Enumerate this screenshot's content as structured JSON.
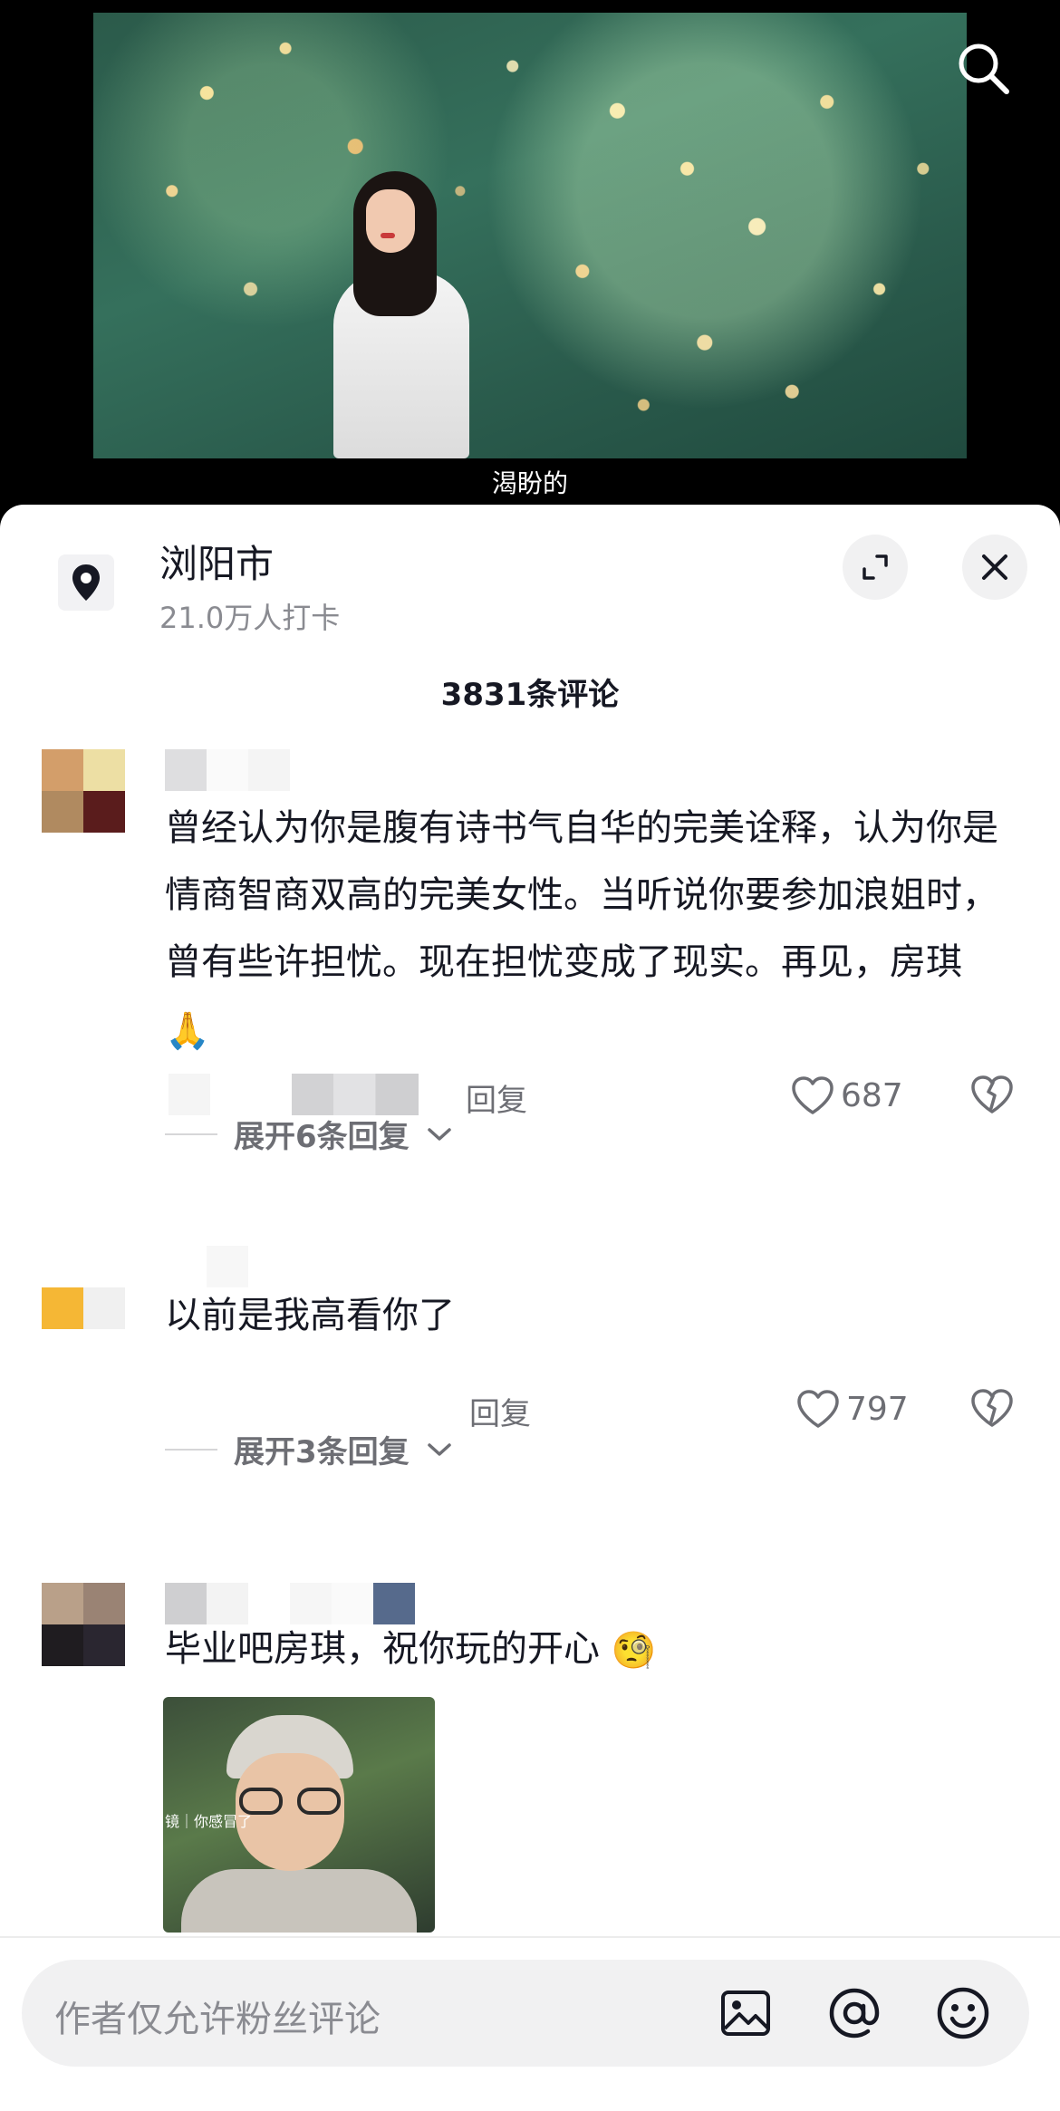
{
  "video": {
    "caption": "渴盼的"
  },
  "location": {
    "name": "浏阳市",
    "checkins": "21.0万人打卡"
  },
  "comments_header": {
    "count_label": "3831条评论"
  },
  "comments": [
    {
      "text": "曾经认为你是腹有诗书气自华的完美诠释，认为你是情商智商双高的完美女性。当听说你要参加浪姐时，曾有些许担忧。现在担忧变成了现实。再见，房琪",
      "emoji": "🙏",
      "reply_label": "回复",
      "likes": "687",
      "expand_label": "展开6条回复",
      "avatar_colors": [
        "#d39e6a",
        "#eddfa4",
        "#b08a60",
        "#5a1c1c"
      ]
    },
    {
      "text": "以前是我高看你了",
      "reply_label": "回复",
      "likes": "797",
      "expand_label": "展开3条回复",
      "avatar_colors": [
        "#ffffff",
        "#ffffff",
        "#f5b735",
        "#f0f0f0"
      ]
    },
    {
      "text": "毕业吧房琪，祝你玩的开心",
      "emoji": "🧐",
      "image_overlay_text": "镜｜你感冒了",
      "avatar_colors": [
        "#b9a089",
        "#9a8374",
        "#1f1c20",
        "#2a2630"
      ]
    }
  ],
  "input": {
    "placeholder": "作者仅允许粉丝评论"
  },
  "icons": {
    "search": "search-icon",
    "location": "location-pin-icon",
    "expand": "expand-icon",
    "close": "close-icon",
    "like": "heart-icon",
    "dislike": "broken-heart-icon",
    "chevron": "chevron-down-icon",
    "image": "image-icon",
    "mention": "at-icon",
    "emoji": "emoji-icon"
  }
}
